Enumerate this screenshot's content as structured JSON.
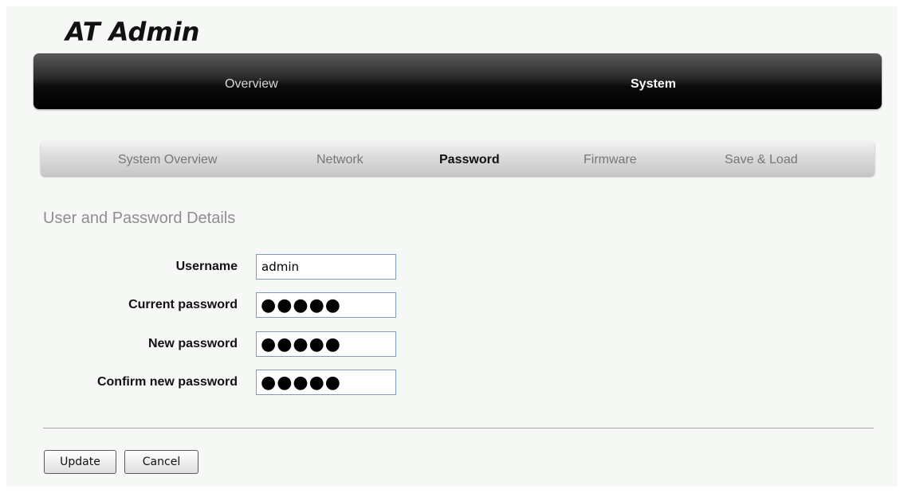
{
  "app": {
    "title": "AT Admin"
  },
  "main_nav": {
    "items": [
      {
        "label": "Overview",
        "active": false
      },
      {
        "label": "System",
        "active": true
      }
    ]
  },
  "sub_nav": {
    "items": [
      {
        "label": "System Overview",
        "active": false
      },
      {
        "label": "Network",
        "active": false
      },
      {
        "label": "Password",
        "active": true
      },
      {
        "label": "Firmware",
        "active": false
      },
      {
        "label": "Save & Load",
        "active": false
      }
    ]
  },
  "form": {
    "heading": "User and Password Details",
    "fields": [
      {
        "label": "Username",
        "type": "text",
        "value": "admin"
      },
      {
        "label": "Current password",
        "type": "password",
        "value": "●●●●●"
      },
      {
        "label": "New password",
        "type": "password",
        "value": "●●●●●"
      },
      {
        "label": "Confirm new password",
        "type": "password",
        "value": "●●●●●"
      }
    ]
  },
  "actions": {
    "update_label": "Update",
    "cancel_label": "Cancel"
  },
  "colors": {
    "page_background": "#f6f8f6",
    "main_nav_background": "#000000",
    "sub_nav_background": "#d4d4d4",
    "heading_text": "#8e8e8e",
    "input_border": "#7f9db9"
  }
}
